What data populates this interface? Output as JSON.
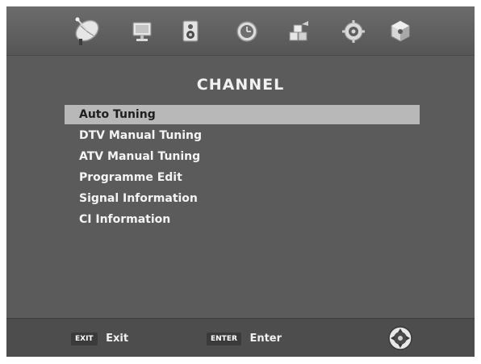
{
  "tabs": [
    {
      "id": "channel",
      "icon": "satellite-dish-icon",
      "active": true
    },
    {
      "id": "picture",
      "icon": "monitor-icon",
      "active": false
    },
    {
      "id": "sound",
      "icon": "speaker-icon",
      "active": false
    },
    {
      "id": "time",
      "icon": "clock-icon",
      "active": false
    },
    {
      "id": "lock",
      "icon": "lock-blocks-icon",
      "active": false
    },
    {
      "id": "setup",
      "icon": "gear-icon",
      "active": false
    },
    {
      "id": "usb",
      "icon": "cube-icon",
      "active": false
    }
  ],
  "page": {
    "title": "CHANNEL"
  },
  "menu": {
    "items": [
      {
        "label": "Auto Tuning",
        "selected": true
      },
      {
        "label": "DTV Manual Tuning",
        "selected": false
      },
      {
        "label": "ATV Manual Tuning",
        "selected": false
      },
      {
        "label": "Programme Edit",
        "selected": false
      },
      {
        "label": "Signal Information",
        "selected": false
      },
      {
        "label": "CI Information",
        "selected": false
      }
    ]
  },
  "footer": {
    "exit": {
      "key": "EXIT",
      "label": "Exit"
    },
    "enter": {
      "key": "ENTER",
      "label": "Enter"
    },
    "nav_icon": "dpad-icon"
  },
  "colors": {
    "background": "#5b5b5b",
    "highlight": "#b8b8b8",
    "text": "#f4f4f4"
  }
}
